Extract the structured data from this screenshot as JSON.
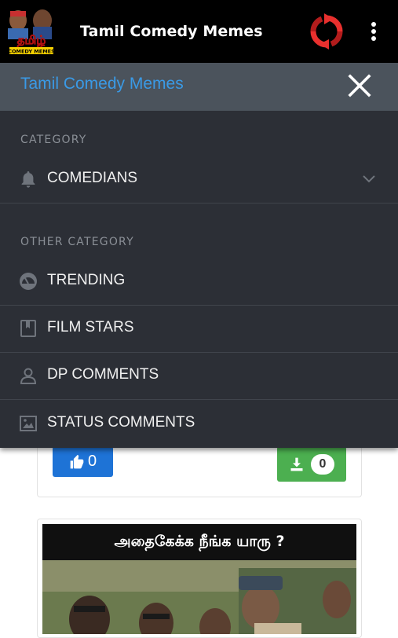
{
  "app_bar": {
    "title": "Tamil Comedy Memes",
    "logo_text": "தமிழ்",
    "logo_subtext": "COMEDY MEMES"
  },
  "drawer": {
    "title": "Tamil Comedy Memes",
    "category_label": "CATEGORY",
    "category_items": [
      {
        "label": "COMEDIANS",
        "icon": "bell-icon"
      }
    ],
    "other_category_label": "OTHER CATEGORY",
    "other_items": [
      {
        "label": "TRENDING",
        "icon": "gauge-icon"
      },
      {
        "label": "FILM STARS",
        "icon": "bookmark-icon"
      },
      {
        "label": "DP COMMENTS",
        "icon": "person-icon"
      },
      {
        "label": "STATUS COMMENTS",
        "icon": "image-icon"
      }
    ]
  },
  "feed": {
    "like_count": "0",
    "download_count": "0",
    "meme_caption": "அதைகேக்க நீங்க யாரு ?"
  },
  "colors": {
    "app_bar": "#000000",
    "drawer_bg": "#2c2f36",
    "drawer_header": "#4b535c",
    "drawer_title": "#3a9ae6",
    "like_button": "#1e73d6",
    "download_button": "#4caf50"
  }
}
